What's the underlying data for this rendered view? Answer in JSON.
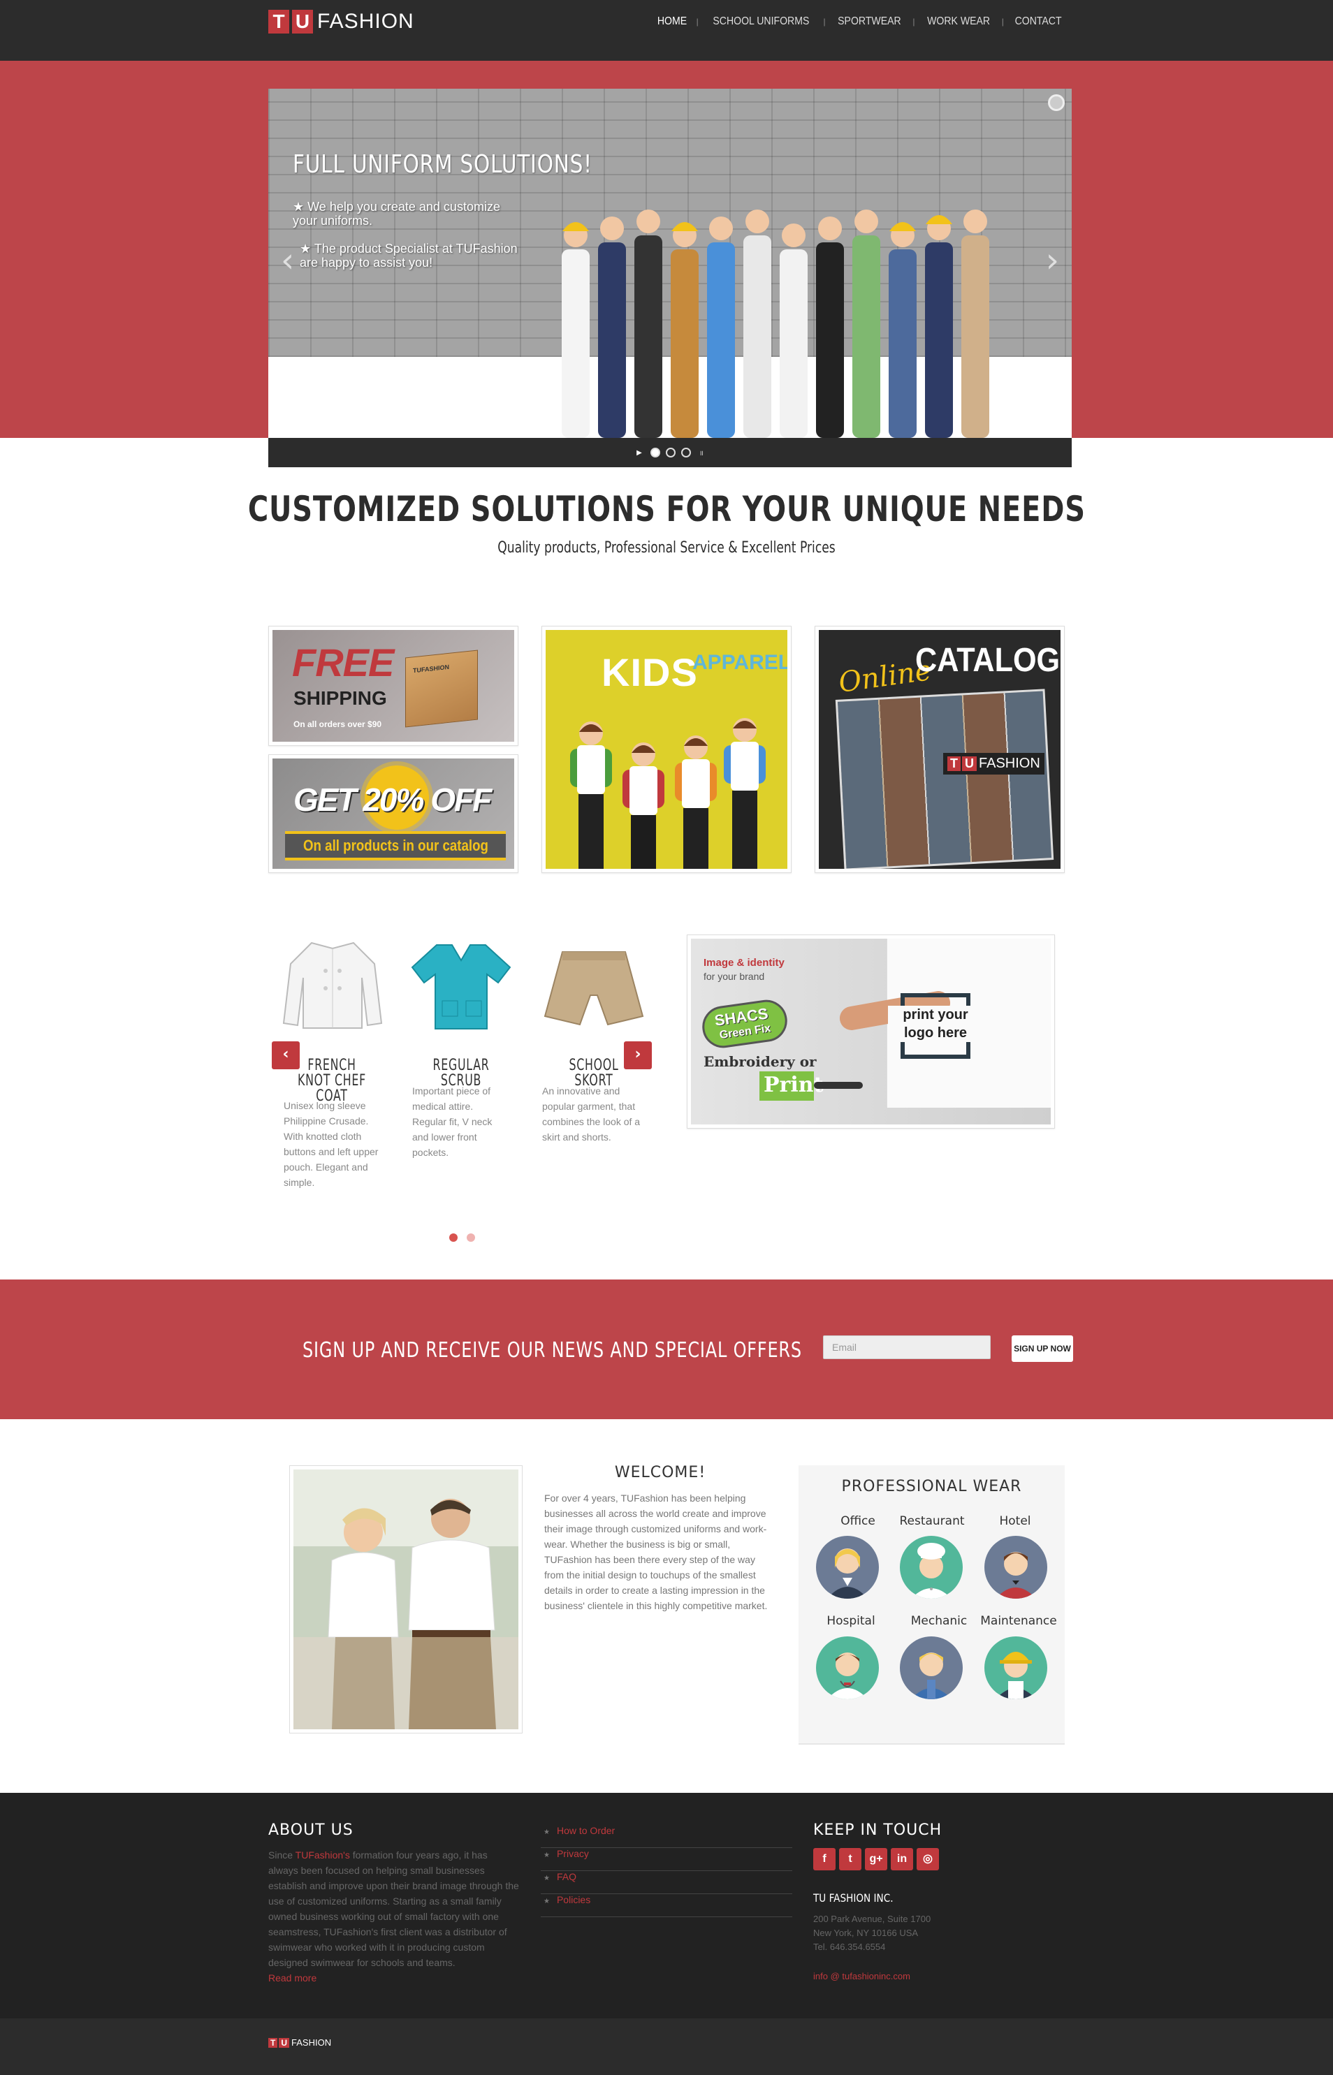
{
  "brand": {
    "logo_letters": [
      "T",
      "U"
    ],
    "logo_word": "FASHION"
  },
  "nav": {
    "items": [
      {
        "label": "HOME",
        "active": true
      },
      {
        "label": "SCHOOL UNIFORMS"
      },
      {
        "label": "SPORTWEAR"
      },
      {
        "label": "WORK WEAR"
      },
      {
        "label": "CONTACT"
      }
    ]
  },
  "hero": {
    "title": "FULL UNIFORM SOLUTIONS!",
    "bullet1": "★ We help you create and customize your uniforms.",
    "bullet2": "★ The product Specialist at TUFashion are happy to assist you!",
    "prev_glyph": "‹",
    "next_glyph": "›",
    "play_glyph": "▶",
    "pause_glyph": "⏸",
    "slides": 3,
    "active_slide": 1
  },
  "headline": {
    "title": "CUSTOMIZED SOLUTIONS FOR YOUR UNIQUE NEEDS",
    "subtitle": "Quality products, Professional Service & Excellent Prices"
  },
  "promos": {
    "free_shipping": {
      "big": "FREE",
      "small": "SHIPPING",
      "note": "On all orders over $90",
      "box_text": "TUFASHION"
    },
    "discount": {
      "big": "GET 20% OFF",
      "note": "On all products in our catalog"
    },
    "kids": {
      "word1": "KIDS",
      "word2": "APPAREL"
    },
    "catalog": {
      "word1": "Online",
      "word2": "CATALOG",
      "logo_letters": [
        "T",
        "U"
      ],
      "logo_word": "FASHION"
    }
  },
  "products": {
    "prev_glyph": "‹",
    "next_glyph": "›",
    "items": [
      {
        "title": "FRENCH KNOT CHEF COAT",
        "desc": "Unisex long sleeve Philippine Crusade. With knotted cloth buttons and left upper pouch. Elegant and simple."
      },
      {
        "title": "REGULAR SCRUB",
        "desc": "Important piece of medical attire. Regular fit, V neck and lower front pockets."
      },
      {
        "title": "SCHOOL SKORT",
        "desc": "An innovative and popular garment, that combines the look of a skirt and shorts."
      }
    ],
    "pages": 2,
    "active_page": 1
  },
  "print_promo": {
    "line1": "Image & identity",
    "line2": "for your brand",
    "badge1": "SHACS",
    "badge2": "Green Fix",
    "line3": "Embroidery or",
    "line4": "Print",
    "logo_text": "print your logo here"
  },
  "signup": {
    "text": "SIGN UP AND RECEIVE OUR NEWS AND SPECIAL OFFERS",
    "email_placeholder": "Email",
    "button": "SIGN UP NOW"
  },
  "welcome": {
    "title": "WELCOME!",
    "text": "For over 4 years, TUFashion has been helping businesses all across the world create and improve their image through customized uniforms and work-wear. Whether the business is big or small, TUFashion has been there every step of the way from the initial design to touchups of the smallest details in order to create a lasting impression in the business' clientele in this highly competitive market."
  },
  "professional": {
    "title": "PROFESSIONAL WEAR",
    "items": [
      "Office",
      "Restaurant",
      "Hotel",
      "Hospital",
      "Mechanic",
      "Maintenance"
    ]
  },
  "footer": {
    "about": {
      "title": "ABOUT US",
      "prefix": "Since ",
      "brand": "TUFashion's",
      "text": " formation four years ago, it has always been focused on helping small businesses establish and improve upon their brand image through the use of customized uniforms. Starting as a small family owned business working out of small factory with one seamstress, TUFashion's first client was a distributor of swimwear who worked with it in producing custom designed swimwear for schools and teams.",
      "more": "Read more"
    },
    "links": [
      "How to Order",
      "Privacy",
      "FAQ",
      "Policies"
    ],
    "keep": {
      "title": "KEEP IN TOUCH",
      "social": [
        "f",
        "t",
        "g+",
        "in",
        "◎"
      ],
      "company": "TU FASHION INC.",
      "addr1": "200 Park Avenue, Suite 1700",
      "addr2": "New York, NY 10166 USA",
      "phone": "Tel. 646.354.6554",
      "email": "info @ tufashioninc.com"
    },
    "bottom_logo_letters": [
      "T",
      "U"
    ],
    "bottom_logo_word": "FASHION"
  },
  "colors": {
    "brand_red": "#c0393d",
    "dark": "#2c2c2c",
    "hero_red": "#bd454a"
  }
}
